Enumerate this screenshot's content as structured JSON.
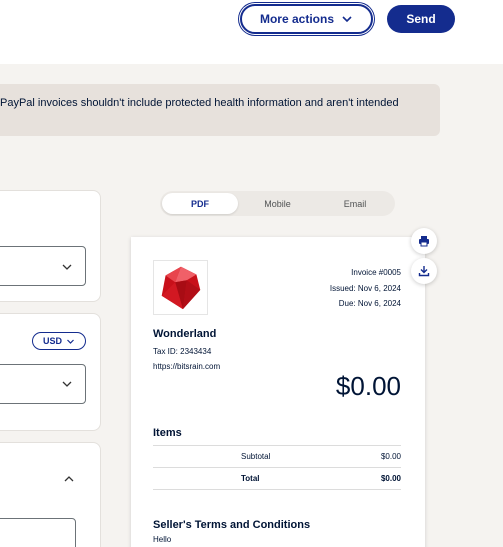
{
  "header": {
    "more_actions_label": "More actions",
    "send_label": "Send"
  },
  "banner": {
    "text": "PayPal invoices shouldn't include protected health information and aren't intended"
  },
  "form": {
    "currency_label": "USD"
  },
  "preview_tabs": [
    {
      "label": "PDF",
      "active": true
    },
    {
      "label": "Mobile",
      "active": false
    },
    {
      "label": "Email",
      "active": false
    }
  ],
  "invoice": {
    "number": "Invoice #0005",
    "issued": "Issued: Nov 6, 2024",
    "due": "Due: Nov 6, 2024",
    "business_name": "Wonderland",
    "tax_id": "Tax ID: 2343434",
    "website": "https://bitsrain.com",
    "amount": "$0.00",
    "items_heading": "Items",
    "subtotal_label": "Subtotal",
    "subtotal_value": "$0.00",
    "total_label": "Total",
    "total_value": "$0.00",
    "terms_heading": "Seller's Terms and Conditions",
    "terms_text": "Hello"
  },
  "icons": {
    "print": "printer-icon",
    "download": "download-icon",
    "logo": "ruby-gem-logo"
  },
  "colors": {
    "primary": "#142c8e",
    "banner_bg": "#e7e1dc",
    "page_bg": "#f5f3f0",
    "ruby": "#d8141e"
  }
}
